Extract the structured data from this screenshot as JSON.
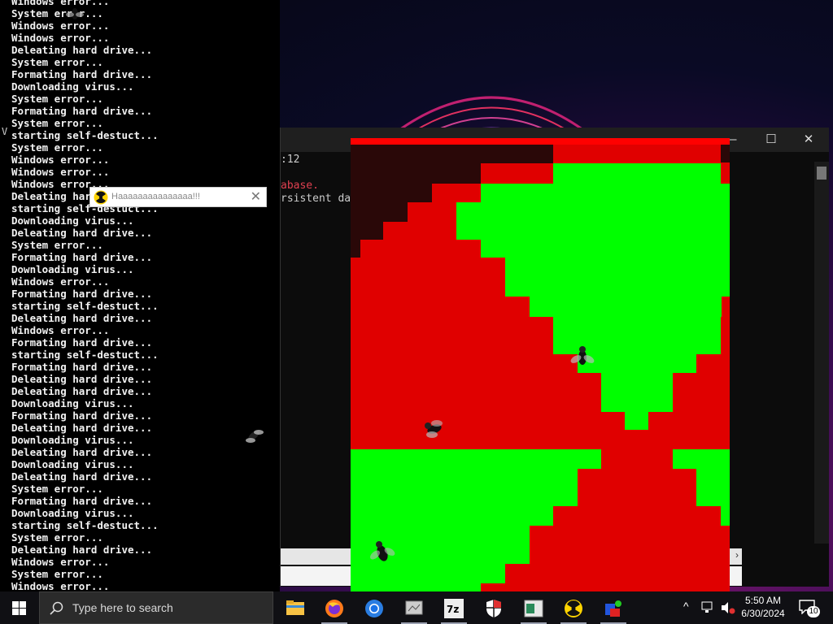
{
  "console": {
    "lines": [
      "Windows error...",
      "System error...",
      "Windows error...",
      "Windows error...",
      "Deleating hard drive...",
      "System error...",
      "Formating hard drive...",
      "Downloading virus...",
      "System error...",
      "Formating hard drive...",
      "System error...",
      "starting self-destuct...",
      "System error...",
      "Windows error...",
      "Windows error...",
      "Windows error...",
      "Deleating hard drive...",
      "starting self-destuct...",
      "Downloading virus...",
      "Deleating hard drive...",
      "System error...",
      "Formating hard drive...",
      "Downloading virus...",
      "Windows error...",
      "Formating hard drive...",
      "starting self-destuct...",
      "Deleating hard drive...",
      "Windows error...",
      "Formating hard drive...",
      "starting self-destuct...",
      "Formating hard drive...",
      "Deleating hard drive...",
      "Deleating hard drive...",
      "Downloading virus...",
      "Formating hard drive...",
      "Deleating hard drive...",
      "Downloading virus...",
      "Deleating hard drive...",
      "Downloading virus...",
      "Deleating hard drive...",
      "System error...",
      "Formating hard drive...",
      "Downloading virus...",
      "starting self-destuct...",
      "System error...",
      "Deleating hard drive...",
      "Windows error...",
      "System error...",
      "Windows error..."
    ]
  },
  "background_window": {
    "line1": ":12",
    "line2": "abase.",
    "line3": "rsistent da",
    "minimize": "—",
    "maximize": "☐",
    "close": "✕"
  },
  "popup": {
    "title": "Haaaaaaaaaaaaaaa!!!",
    "close": "✕"
  },
  "taskbar": {
    "search_placeholder": "Type here to search",
    "time": "5:50 AM",
    "date": "6/30/2024",
    "notification_count": "10",
    "pinned": [
      "file-explorer",
      "firefox",
      "chrome",
      "app",
      "7zip",
      "security",
      "app-window",
      "radioactive-app",
      "paint-app"
    ]
  },
  "colors": {
    "red": "#e00000",
    "green": "#00ff00",
    "dark": "#2a0a0a"
  }
}
